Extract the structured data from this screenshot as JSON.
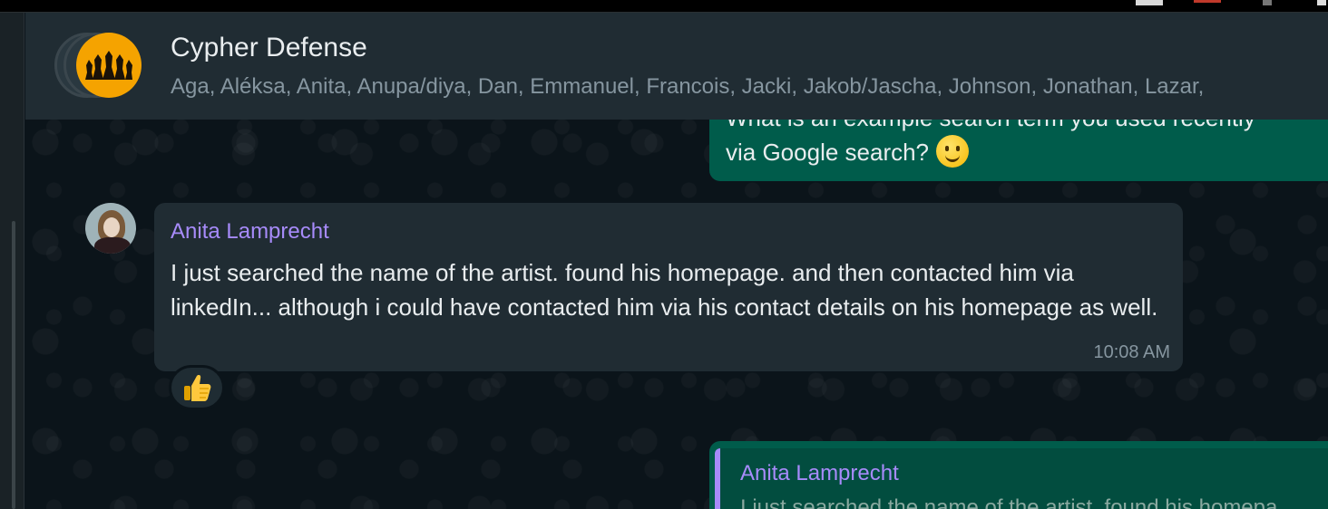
{
  "header": {
    "title": "Cypher Defense",
    "members": "Aga, Aléksa, Anita, Anupa/diya, Dan, Emmanuel, Francois, Jacki, Jakob/Jascha, Johnson, Jonathan, Lazar,"
  },
  "messages": [
    {
      "direction": "outgoing",
      "line1": "What is an example search term you used recently",
      "line2": "via Google search?",
      "emoji": "slightly-smiling-face"
    },
    {
      "direction": "incoming",
      "sender": "Anita Lamprecht",
      "text": "I just searched the name of the artist. found his homepage. and then contacted him via linkedIn... although i  could have contacted him via his contact details on his homepage as well.",
      "time": "10:08 AM",
      "reaction": "👍"
    },
    {
      "direction": "outgoing",
      "quote_sender": "Anita Lamprecht",
      "quote_text": "I just searched the name of the artist. found his homepa"
    }
  ],
  "colors": {
    "outgoing_bubble": "#005c4b",
    "incoming_bubble": "#202c33",
    "sender_name": "#a78bfa",
    "header_bg": "#202c33",
    "group_avatar": "#f5a300"
  }
}
